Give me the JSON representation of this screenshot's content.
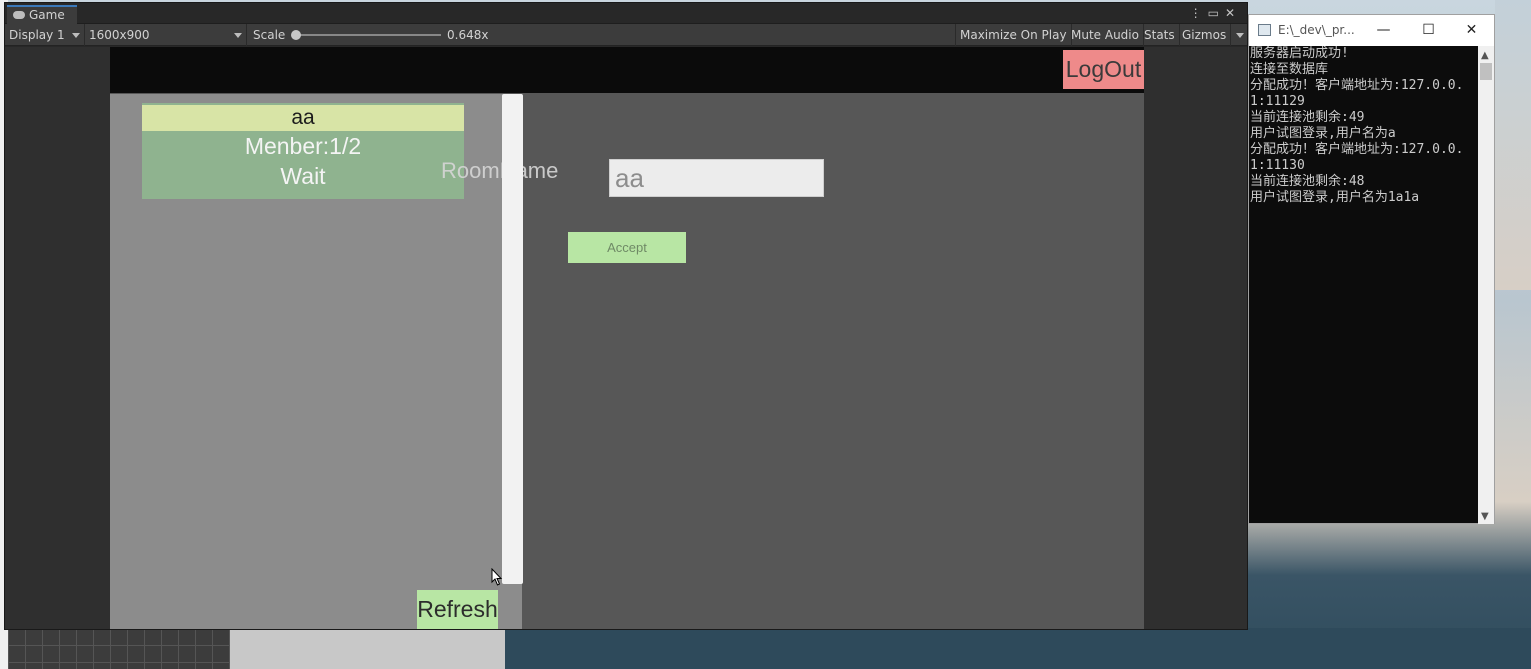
{
  "game_window": {
    "tab_label": "Game",
    "toolbar": {
      "display": "Display 1",
      "resolution": "1600x900",
      "scale_label": "Scale",
      "scale_value": "0.648x",
      "maximize_on_play": "Maximize On Play",
      "mute_audio": "Mute Audio",
      "stats": "Stats",
      "gizmos": "Gizmos"
    }
  },
  "game": {
    "logout_label": "LogOut",
    "room_list": [
      {
        "name": "aa",
        "members": "Menber:1/2",
        "status": "Wait"
      }
    ],
    "refresh_label": "Refresh",
    "room_name_label": "RoomName",
    "room_name_input": "aa",
    "accept_label": "Accept"
  },
  "console": {
    "title": "E:\\_dev\\_pr...",
    "lines": [
      "服务器启动成功!",
      "连接至数据库",
      "分配成功！客户端地址为:127.0.0.1:11129",
      "当前连接池剩余:49",
      "用户试图登录,用户名为a",
      "分配成功！客户端地址为:127.0.0.1:11130",
      "当前连接池剩余:48",
      "用户试图登录,用户名为1a1a"
    ]
  },
  "colors": {
    "logout_button": "#ee8a8a",
    "accept_button": "#b8e6a4",
    "room_card": "#8fb38f",
    "room_name_bar": "#d8e4a6"
  },
  "scale_slider_level": 0.0
}
